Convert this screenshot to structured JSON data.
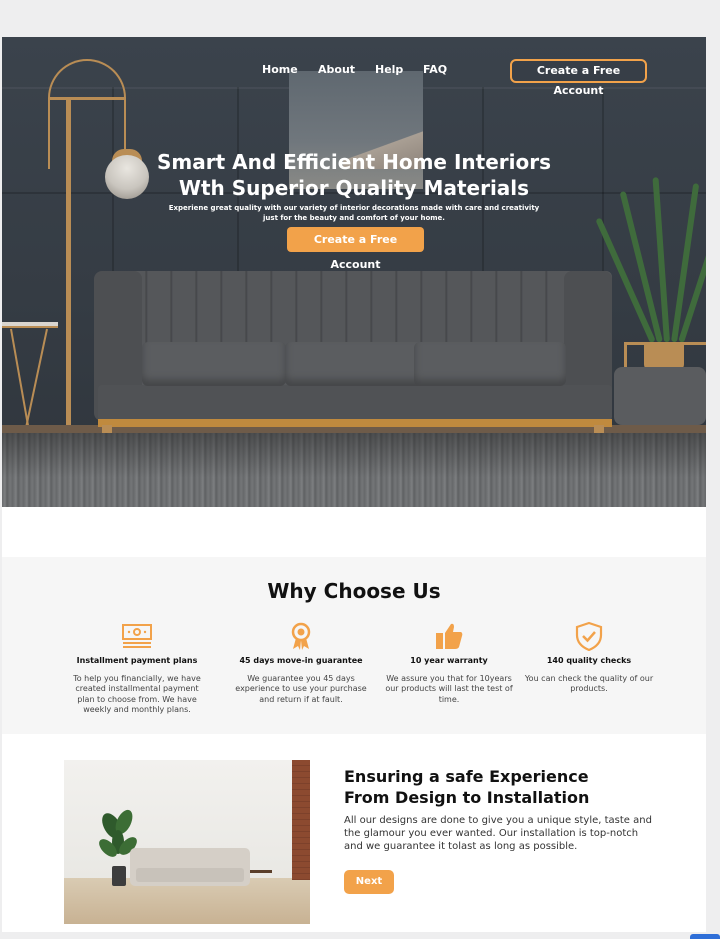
{
  "nav": {
    "links": [
      "Home",
      "About",
      "Help",
      "FAQ"
    ],
    "cta_label": "Create a Free Account"
  },
  "hero": {
    "headline_line1": "Smart And Efficient Home Interiors",
    "headline_line2": "Wth Superior Quality Materials",
    "sub_line1": "Experiene great quality with our variety of interior decorations made with care and creativity",
    "sub_line2": "just for the beauty and comfort of your home.",
    "cta_label": "Create a Free Account"
  },
  "why": {
    "title": "Why Choose Us",
    "features": [
      {
        "icon": "money-icon",
        "title": "Installment payment plans",
        "text": "To help you financially, we have created installmental payment plan to choose from. We have weekly and monthly plans."
      },
      {
        "icon": "award-ribbon-icon",
        "title": "45 days move-in guarantee",
        "text": "We guarantee you 45 days experience to use your purchase and return if at fault."
      },
      {
        "icon": "thumbs-up-icon",
        "title": "10 year warranty",
        "text": "We assure you that for 10years our products will last the test of time."
      },
      {
        "icon": "shield-check-icon",
        "title": "140 quality checks",
        "text": "You can check the quality of our products."
      }
    ]
  },
  "safe": {
    "title_line1": "Ensuring a safe Experience",
    "title_line2": "From Design to Installation",
    "text": "All our designs are done to give you a unique style, taste and the glamour you ever wanted. Our installation is top-notch and we guarantee it tolast as long as possible.",
    "next_label": "Next"
  },
  "colors": {
    "accent": "#f2a24a",
    "hero_wall": "#3b434c",
    "brass": "#b98d55"
  }
}
